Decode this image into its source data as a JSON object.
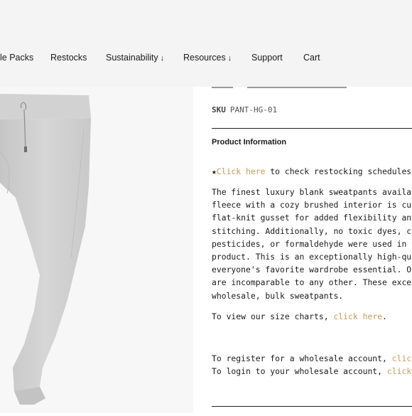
{
  "nav": {
    "items": [
      {
        "label": "le Packs"
      },
      {
        "label": "Restocks"
      },
      {
        "label": "Sustainability",
        "arrow": "↓"
      },
      {
        "label": "Resources",
        "arrow": "↓"
      },
      {
        "label": "Support"
      },
      {
        "label": "Cart"
      }
    ]
  },
  "product": {
    "sku_label": "SKU",
    "sku_value": "PANT-HG-01",
    "info_heading": "Product Information",
    "restock": {
      "star": "★",
      "link": "Click here",
      "text": " to check restocking schedules★"
    },
    "description_lines": [
      "The finest luxury blank sweatpants availab",
      "fleece with a cozy brushed interior is cut",
      "flat-knit gusset for added flexibility and",
      "stitching. Additionally, no toxic dyes, ch",
      "pesticides, or formaldehyde were used in t",
      "product. This is an exceptionally high-qua",
      "everyone's favorite wardrobe essential. Ou",
      "are incomparable to any other. These excee",
      "wholesale, bulk sweatpants."
    ],
    "size_chart": {
      "prefix": "To view our size charts, ",
      "link": "click here",
      "suffix": "."
    },
    "wholesale_register": {
      "prefix": "To register for a wholesale account, ",
      "link": "click"
    },
    "wholesale_login": {
      "prefix": "To login to your wholesale account, ",
      "link": "click"
    }
  },
  "colors": {
    "accent": "#c49a5a",
    "topbar": "#f4f4f4",
    "image_bg": "#f7f7f7",
    "fabric": "#cfcfcf"
  }
}
